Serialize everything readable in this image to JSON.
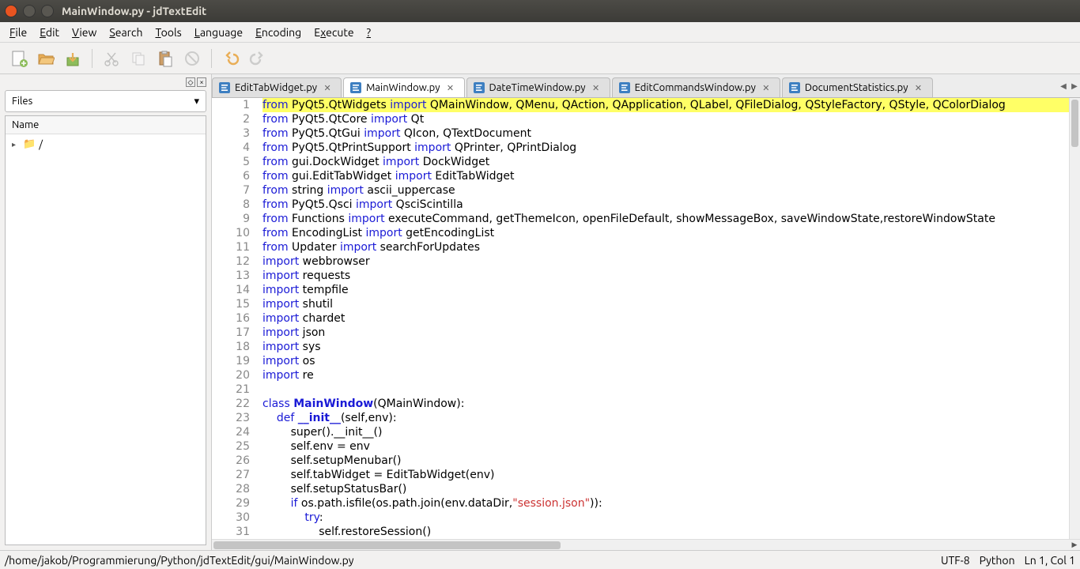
{
  "window": {
    "title": "MainWindow.py - jdTextEdit"
  },
  "menus": [
    "File",
    "Edit",
    "View",
    "Search",
    "Tools",
    "Language",
    "Encoding",
    "Execute",
    "?"
  ],
  "sidebar": {
    "selector": "Files",
    "tree_header": "Name",
    "root_label": "/"
  },
  "tabs": [
    {
      "label": "EditTabWidget.py",
      "active": false
    },
    {
      "label": "MainWindow.py",
      "active": true
    },
    {
      "label": "DateTimeWindow.py",
      "active": false
    },
    {
      "label": "EditCommandsWindow.py",
      "active": false
    },
    {
      "label": "DocumentStatistics.py",
      "active": false
    }
  ],
  "code": {
    "lines": [
      [
        [
          "kw",
          "from"
        ],
        [
          "plain",
          " PyQt5.QtWidgets "
        ],
        [
          "kw",
          "import"
        ],
        [
          "plain",
          " QMainWindow, QMenu, QAction, QApplication, QLabel, QFileDialog, QStyleFactory, QStyle, QColorDialog"
        ]
      ],
      [
        [
          "kw",
          "from"
        ],
        [
          "plain",
          " PyQt5.QtCore "
        ],
        [
          "kw",
          "import"
        ],
        [
          "plain",
          " Qt"
        ]
      ],
      [
        [
          "kw",
          "from"
        ],
        [
          "plain",
          " PyQt5.QtGui "
        ],
        [
          "kw",
          "import"
        ],
        [
          "plain",
          " QIcon, QTextDocument"
        ]
      ],
      [
        [
          "kw",
          "from"
        ],
        [
          "plain",
          " PyQt5.QtPrintSupport "
        ],
        [
          "kw",
          "import"
        ],
        [
          "plain",
          " QPrinter, QPrintDialog"
        ]
      ],
      [
        [
          "kw",
          "from"
        ],
        [
          "plain",
          " gui.DockWidget "
        ],
        [
          "kw",
          "import"
        ],
        [
          "plain",
          " DockWidget"
        ]
      ],
      [
        [
          "kw",
          "from"
        ],
        [
          "plain",
          " gui.EditTabWidget "
        ],
        [
          "kw",
          "import"
        ],
        [
          "plain",
          " EditTabWidget"
        ]
      ],
      [
        [
          "kw",
          "from"
        ],
        [
          "plain",
          " string "
        ],
        [
          "kw",
          "import"
        ],
        [
          "plain",
          " ascii_uppercase"
        ]
      ],
      [
        [
          "kw",
          "from"
        ],
        [
          "plain",
          " PyQt5.Qsci "
        ],
        [
          "kw",
          "import"
        ],
        [
          "plain",
          " QsciScintilla"
        ]
      ],
      [
        [
          "kw",
          "from"
        ],
        [
          "plain",
          " Functions "
        ],
        [
          "kw",
          "import"
        ],
        [
          "plain",
          " executeCommand, getThemeIcon, openFileDefault, showMessageBox, saveWindowState,restoreWindowState"
        ]
      ],
      [
        [
          "kw",
          "from"
        ],
        [
          "plain",
          " EncodingList "
        ],
        [
          "kw",
          "import"
        ],
        [
          "plain",
          " getEncodingList"
        ]
      ],
      [
        [
          "kw",
          "from"
        ],
        [
          "plain",
          " Updater "
        ],
        [
          "kw",
          "import"
        ],
        [
          "plain",
          " searchForUpdates"
        ]
      ],
      [
        [
          "kw",
          "import"
        ],
        [
          "plain",
          " webbrowser"
        ]
      ],
      [
        [
          "kw",
          "import"
        ],
        [
          "plain",
          " requests"
        ]
      ],
      [
        [
          "kw",
          "import"
        ],
        [
          "plain",
          " tempfile"
        ]
      ],
      [
        [
          "kw",
          "import"
        ],
        [
          "plain",
          " shutil"
        ]
      ],
      [
        [
          "kw",
          "import"
        ],
        [
          "plain",
          " chardet"
        ]
      ],
      [
        [
          "kw",
          "import"
        ],
        [
          "plain",
          " json"
        ]
      ],
      [
        [
          "kw",
          "import"
        ],
        [
          "plain",
          " sys"
        ]
      ],
      [
        [
          "kw",
          "import"
        ],
        [
          "plain",
          " os"
        ]
      ],
      [
        [
          "kw",
          "import"
        ],
        [
          "plain",
          " re"
        ]
      ],
      [
        [
          "plain",
          ""
        ]
      ],
      [
        [
          "kw",
          "class "
        ],
        [
          "cls",
          "MainWindow"
        ],
        [
          "plain",
          "(QMainWindow):"
        ]
      ],
      [
        [
          "plain",
          "    "
        ],
        [
          "kw",
          "def "
        ],
        [
          "fn",
          "__init__"
        ],
        [
          "plain",
          "(self,env):"
        ]
      ],
      [
        [
          "plain",
          "        super().__init__()"
        ]
      ],
      [
        [
          "plain",
          "        self.env = env"
        ]
      ],
      [
        [
          "plain",
          "        self.setupMenubar()"
        ]
      ],
      [
        [
          "plain",
          "        self.tabWidget = EditTabWidget(env)"
        ]
      ],
      [
        [
          "plain",
          "        self.setupStatusBar()"
        ]
      ],
      [
        [
          "plain",
          "        "
        ],
        [
          "kw",
          "if"
        ],
        [
          "plain",
          " os.path.isfile(os.path.join(env.dataDir,"
        ],
        [
          "str",
          "\"session.json\""
        ],
        [
          "plain",
          ")):"
        ]
      ],
      [
        [
          "plain",
          "            "
        ],
        [
          "kw",
          "try"
        ],
        [
          "plain",
          ":"
        ]
      ],
      [
        [
          "plain",
          "                self.restoreSession()"
        ]
      ]
    ],
    "current_line_index": 0
  },
  "status": {
    "path": "/home/jakob/Programmierung/Python/jdTextEdit/gui/MainWindow.py",
    "encoding": "UTF-8",
    "language": "Python",
    "cursor": "Ln 1, Col 1"
  }
}
